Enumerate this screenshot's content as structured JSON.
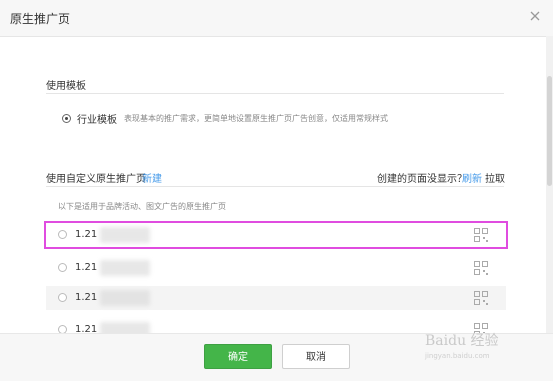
{
  "dialog": {
    "title": "原生推广页"
  },
  "template_section": {
    "label": "使用模板",
    "option_label": "行业模板",
    "option_desc": "表现基本的推广需求，更简单地设置原生推广页广告创意，仅适用常规样式"
  },
  "custom_section": {
    "label": "使用自定义原生推广页",
    "new_link": "新建",
    "hint_prefix": "创建的页面没显示？",
    "refresh_link": "刷新",
    "pull_text": "拉取",
    "desc": "以下是适用于品牌活动、图文广告的原生推广页"
  },
  "list": {
    "rows": [
      {
        "code": "1.21",
        "highlighted": true
      },
      {
        "code": "1.21",
        "highlighted": false
      },
      {
        "code": "1.21",
        "highlighted": false
      },
      {
        "code": "1.21",
        "highlighted": false
      }
    ]
  },
  "footer": {
    "ok_label": "确定",
    "cancel_label": "取消"
  },
  "watermark": {
    "text": "Baidu 经验",
    "sub": "jingyan.baidu.com"
  },
  "colors": {
    "ok_button": "#44b549",
    "link": "#459ae9",
    "highlight": "#e04ce0"
  },
  "icons": [
    "close-icon",
    "qr-code-icon"
  ]
}
